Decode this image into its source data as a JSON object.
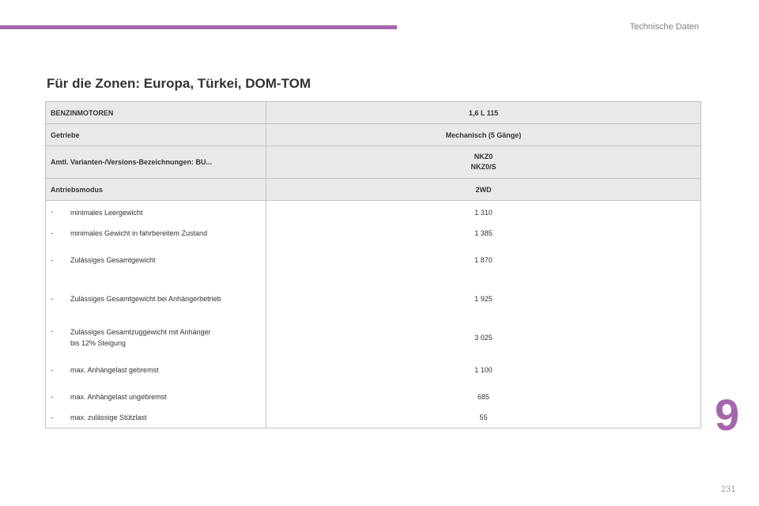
{
  "header": {
    "section_label": "Technische Daten"
  },
  "page": {
    "title": "Für die Zonen: Europa, Türkei, DOM-TOM",
    "chapter_number": "9",
    "page_number": "231"
  },
  "table": {
    "header_rows": [
      {
        "label": "BENZINMOTOREN",
        "value": "1,6 L 115"
      },
      {
        "label": "Getriebe",
        "value": "Mechanisch (5 Gänge)"
      },
      {
        "label": "Amtl. Varianten-/Versions-Bezeichnungen: BU...",
        "value_lines": [
          "NKZ0",
          "NKZ0/S"
        ]
      },
      {
        "label": "Antriebsmodus",
        "value": "2WD"
      }
    ],
    "rows": [
      {
        "dash": "-",
        "label": "minimales Leergewicht",
        "value": "1 310"
      },
      {
        "dash": "-",
        "label": "minimales Gewicht in fahrbereitem Zustand",
        "value": "1 385"
      },
      {
        "dash": "-",
        "label": "Zulässiges Gesamtgewicht",
        "value": "1 870"
      },
      {
        "dash": "-",
        "label": "Zulässiges Gesamtgewicht bei Anhängerbetrieb",
        "value": "1 925"
      },
      {
        "dash": "-",
        "label_lines": [
          "Zulässiges Gesamtzuggewicht mit Anhänger",
          "bis 12% Steigung"
        ],
        "value": "3 025"
      },
      {
        "dash": "-",
        "label": "max. Anhängelast gebremst",
        "value": "1 100"
      },
      {
        "dash": "-",
        "label": "max. Anhängelast ungebremst",
        "value": "685"
      },
      {
        "dash": "-",
        "label": "max. zulässige Stützlast",
        "value": "55"
      }
    ]
  }
}
